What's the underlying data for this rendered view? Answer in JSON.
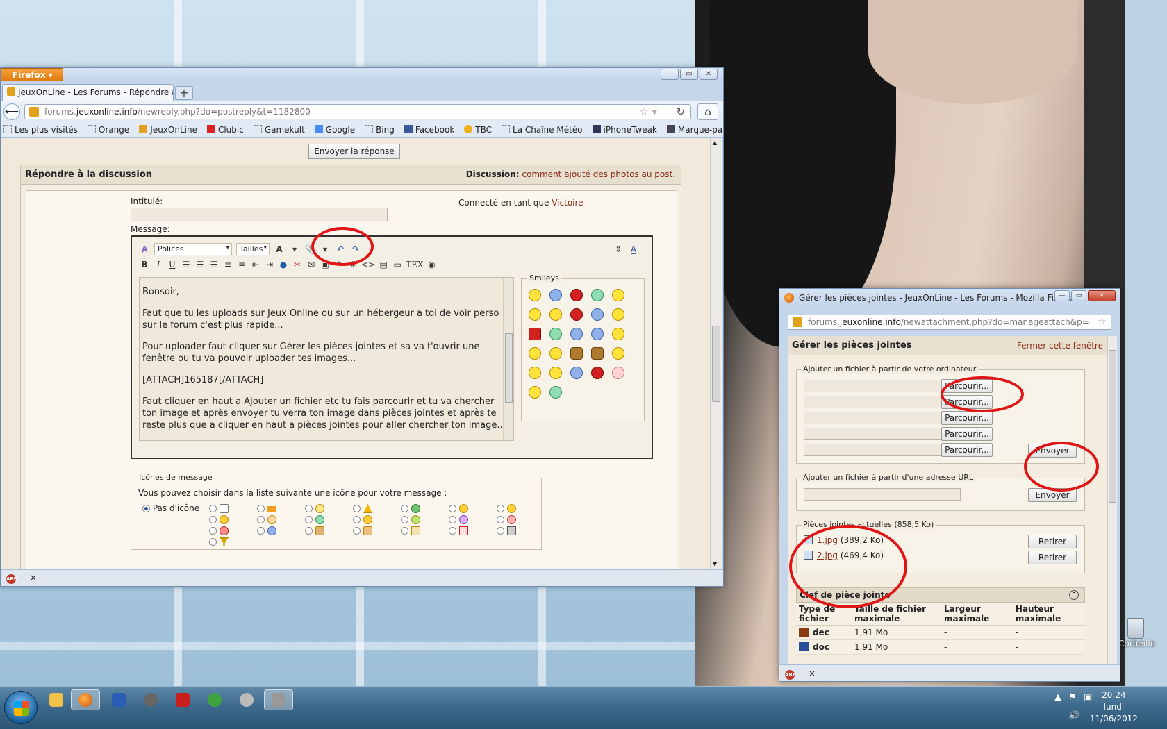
{
  "main_window": {
    "menu_button": "Firefox",
    "tab_title": "JeuxOnLine - Les Forums - Répondre au ...",
    "new_tab": "+",
    "url_domain_prefix": "forums.",
    "url_domain": "jeuxonline.info",
    "url_path": "/newreply.php?do=postreply&t=1182800",
    "bookmarks": [
      "Les plus visités",
      "Orange",
      "JeuxOnLine",
      "Clubic",
      "Gamekult",
      "Google",
      "Bing",
      "Facebook",
      "TBC",
      "La Chaîne Météo",
      "iPhoneTweak"
    ],
    "bookmarks_menu": "Marque-pages",
    "status_close": "×"
  },
  "forum": {
    "send_reply_top": "Envoyer la réponse",
    "reply_heading": "Répondre à la discussion",
    "discussion_label": "Discussion:",
    "discussion_title": "comment ajouté des photos au post.",
    "title_label": "Intitulé:",
    "connected_as": "Connecté en tant que",
    "username": "Victoire",
    "message_label": "Message:",
    "font_select": "Polices",
    "size_select": "Tailles",
    "message_paragraphs": [
      "Bonsoir,",
      " Faut que tu les uploads sur Jeux Online ou sur un hébergeur a toi de voir perso sur le forum c'est plus rapide...",
      " Pour uploader faut cliquer sur Gérer les pièces jointes et sa va t'ouvrir une fenêtre ou tu va pouvoir uploader tes images...",
      " [ATTACH]165187[/ATTACH]",
      " Faut cliquer en haut a Ajouter un fichier etc tu fais parcourir et tu va chercher ton image et après envoyer tu verra ton image dans pièces jointes et après te reste plus que a cliquer en haut a pièces jointes pour aller chercher ton image..."
    ],
    "smileys_legend": "Smileys",
    "message_icons_legend": "Icônes de message",
    "message_icons_desc": "Vous pouvez choisir dans la liste suivante une icône pour votre message :",
    "no_icon": "Pas d'icône"
  },
  "popup": {
    "window_title": "Gérer les pièces jointes - JeuxOnLine - Les Forums - Mozilla Firefox",
    "url_domain_prefix": "forums.",
    "url_domain": "jeuxonline.info",
    "url_path": "/newattachment.php?do=manageattach&p=",
    "heading": "Gérer les pièces jointes",
    "close_link": "Fermer cette fenêtre",
    "add_from_computer": "Ajouter un fichier à partir de votre ordinateur",
    "browse": "Parcourir...",
    "send": "Envoyer",
    "add_from_url": "Ajouter un fichier à partir d'une adresse URL",
    "current_attachments": "Pièces jointes actuelles (858,5 Ko)",
    "attachments": [
      {
        "name": "1.jpg",
        "size": "(389,2 Ko)",
        "remove": "Retirer"
      },
      {
        "name": "2.jpg",
        "size": "(469,4 Ko)",
        "remove": "Retirer"
      }
    ],
    "key_heading": "Clef de pièce jointe",
    "key_columns": [
      "Type de fichier",
      "Taille de fichier maximale",
      "Largeur maximale",
      "Hauteur maximale"
    ],
    "key_rows": [
      {
        "type": "dec",
        "size": "1,91 Mo",
        "width": "-",
        "height": "-"
      },
      {
        "type": "doc",
        "size": "1,91 Mo",
        "width": "-",
        "height": "-"
      }
    ],
    "status_close": "×"
  },
  "desktop": {
    "recycle_label": "Corbeille"
  },
  "taskbar": {
    "time": "20:24",
    "day": "lundi",
    "date": "11/06/2012"
  },
  "colors": {
    "annotation_red": "#e01616",
    "forum_link": "#8a2a14",
    "firefox_orange": "#e07b10"
  }
}
